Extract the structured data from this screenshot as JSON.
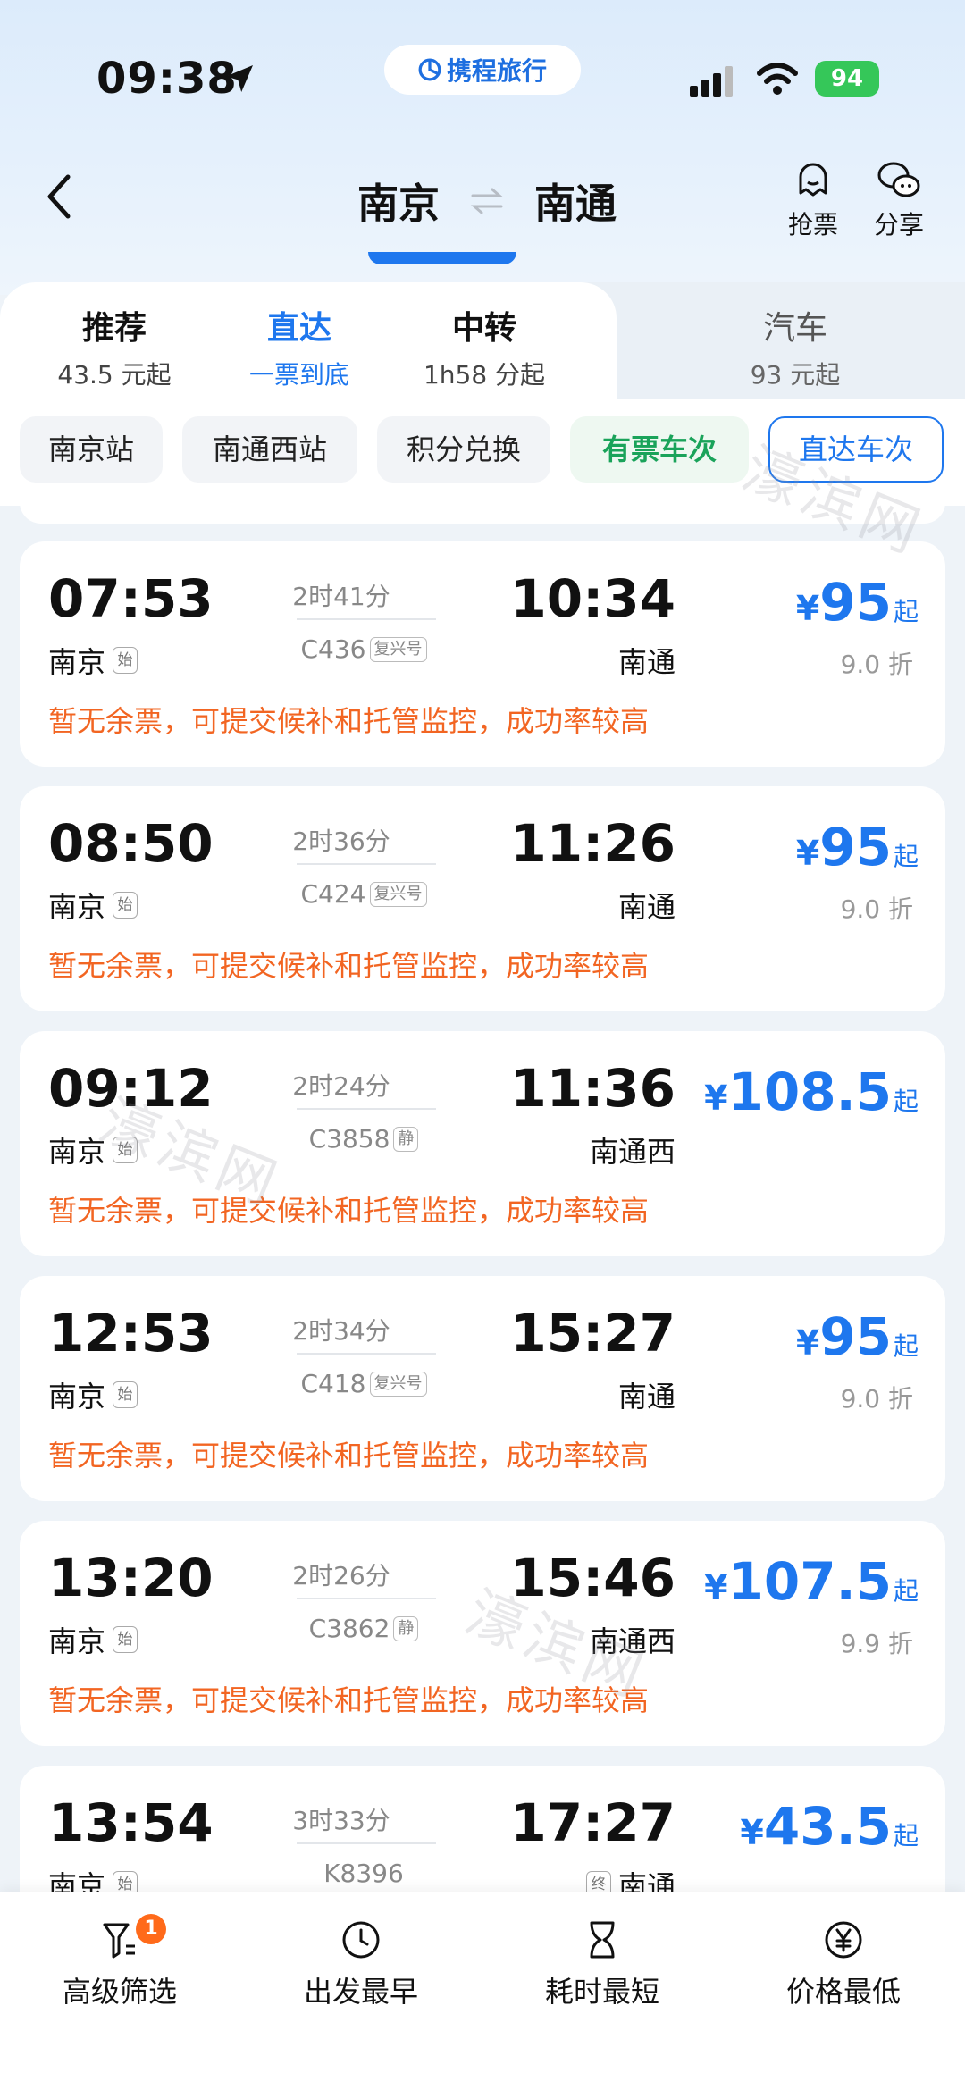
{
  "status_bar": {
    "time": "09:38",
    "battery": "94",
    "brand": "携程旅行"
  },
  "header": {
    "from": "南京",
    "to": "南通",
    "actions": [
      {
        "label": "抢票",
        "icon": "ghost-icon"
      },
      {
        "label": "分享",
        "icon": "wechat-icon"
      }
    ]
  },
  "tabs": [
    {
      "title": "推荐",
      "sub": "43.5 元起"
    },
    {
      "title": "直达",
      "sub": "一票到底"
    },
    {
      "title": "中转",
      "sub": "1h58 分起"
    },
    {
      "title": "汽车",
      "sub": "93 元起"
    }
  ],
  "chips": [
    "南京站",
    "南通西站",
    "积分兑换",
    "有票车次",
    "直达车次"
  ],
  "trains": [
    {
      "dep": "07:53",
      "arr": "10:34",
      "dep_st": "南京",
      "dep_tag": "始",
      "arr_st": "南通",
      "arr_tag": "",
      "duration": "2时41分",
      "no": "C436",
      "type": "复兴号",
      "price": "95",
      "qi": "起",
      "discount": "9.0 折",
      "notice": "暂无余票，可提交候补和托管监控，成功率较高"
    },
    {
      "dep": "08:50",
      "arr": "11:26",
      "dep_st": "南京",
      "dep_tag": "始",
      "arr_st": "南通",
      "arr_tag": "",
      "duration": "2时36分",
      "no": "C424",
      "type": "复兴号",
      "price": "95",
      "qi": "起",
      "discount": "9.0 折",
      "notice": "暂无余票，可提交候补和托管监控，成功率较高"
    },
    {
      "dep": "09:12",
      "arr": "11:36",
      "dep_st": "南京",
      "dep_tag": "始",
      "arr_st": "南通西",
      "arr_tag": "",
      "duration": "2时24分",
      "no": "C3858",
      "type": "静",
      "price": "108.5",
      "qi": "起",
      "discount": "",
      "notice": "暂无余票，可提交候补和托管监控，成功率较高"
    },
    {
      "dep": "12:53",
      "arr": "15:27",
      "dep_st": "南京",
      "dep_tag": "始",
      "arr_st": "南通",
      "arr_tag": "",
      "duration": "2时34分",
      "no": "C418",
      "type": "复兴号",
      "price": "95",
      "qi": "起",
      "discount": "9.0 折",
      "notice": "暂无余票，可提交候补和托管监控，成功率较高"
    },
    {
      "dep": "13:20",
      "arr": "15:46",
      "dep_st": "南京",
      "dep_tag": "始",
      "arr_st": "南通西",
      "arr_tag": "",
      "duration": "2时26分",
      "no": "C3862",
      "type": "静",
      "price": "107.5",
      "qi": "起",
      "discount": "9.9 折",
      "notice": "暂无余票，可提交候补和托管监控，成功率较高"
    },
    {
      "dep": "13:54",
      "arr": "17:27",
      "dep_st": "南京",
      "dep_tag": "始",
      "arr_st": "南通",
      "arr_tag": "终",
      "duration": "3时33分",
      "no": "K8396",
      "type": "",
      "price": "43.5",
      "qi": "起",
      "discount": "",
      "notice": ""
    }
  ],
  "watermark": "濠滨网",
  "bottom_bar": [
    {
      "label": "高级筛选",
      "icon": "filter-icon",
      "badge": "1"
    },
    {
      "label": "出发最早",
      "icon": "clock-icon",
      "badge": ""
    },
    {
      "label": "耗时最短",
      "icon": "hourglass-icon",
      "badge": ""
    },
    {
      "label": "价格最低",
      "icon": "yen-icon",
      "badge": ""
    }
  ],
  "colors": {
    "accent": "#1e77ee",
    "notice": "#f26522",
    "green": "#1aa35a",
    "badge": "#ff6a1a"
  }
}
